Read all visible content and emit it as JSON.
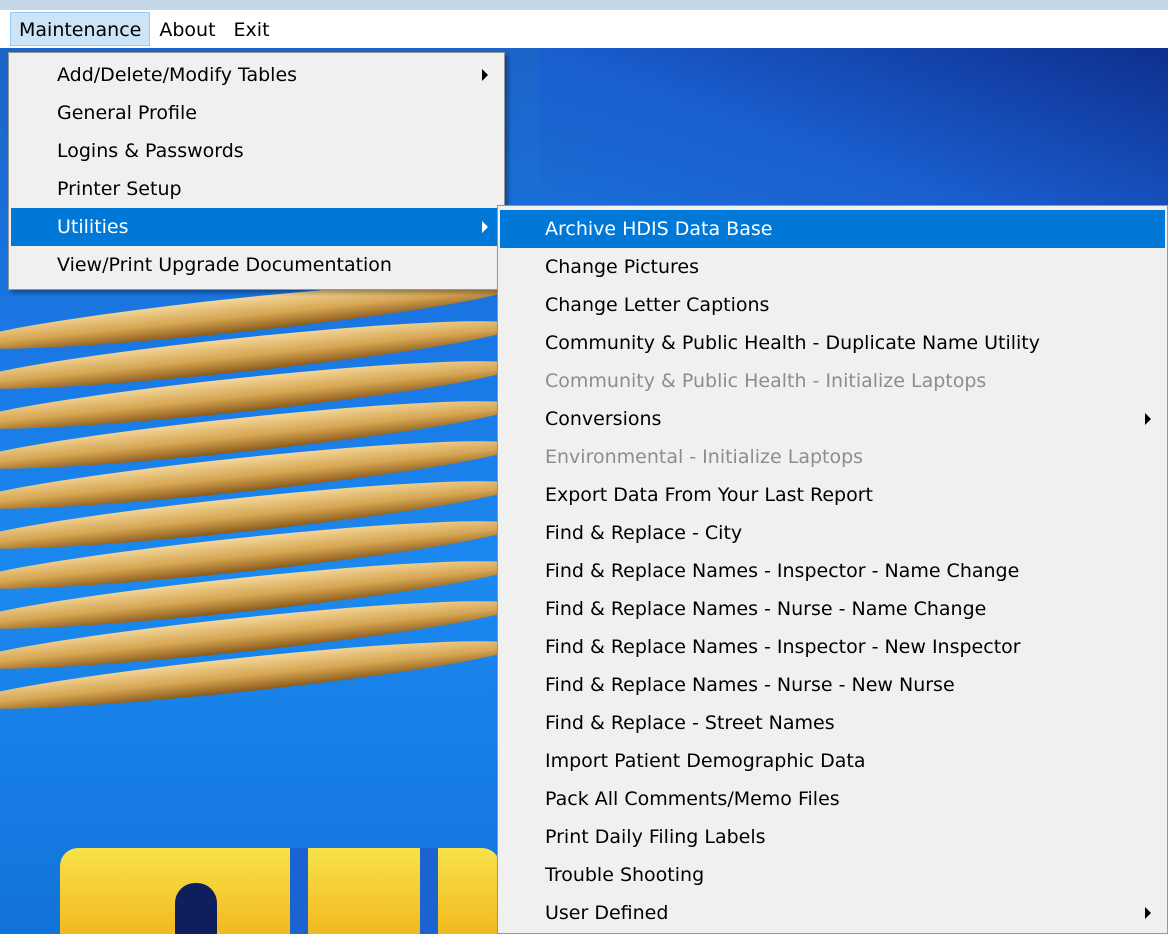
{
  "menubar": {
    "items": [
      "Maintenance",
      "About",
      "Exit"
    ]
  },
  "main_menu": {
    "items": [
      {
        "label": "Add/Delete/Modify Tables",
        "submenu": true
      },
      {
        "label": "General Profile"
      },
      {
        "label": "Logins & Passwords"
      },
      {
        "label": "Printer Setup"
      },
      {
        "label": "Utilities",
        "submenu": true,
        "highlighted": true
      },
      {
        "label": "View/Print Upgrade Documentation"
      }
    ]
  },
  "utilities_menu": {
    "items": [
      {
        "label": "Archive HDIS Data Base",
        "highlighted": true
      },
      {
        "label": "Change Pictures"
      },
      {
        "label": "Change Letter Captions"
      },
      {
        "label": "Community & Public Health - Duplicate Name Utility"
      },
      {
        "label": "Community & Public Health - Initialize Laptops",
        "disabled": true
      },
      {
        "label": "Conversions",
        "submenu": true
      },
      {
        "label": "Environmental - Initialize Laptops",
        "disabled": true
      },
      {
        "label": "Export Data From Your Last Report"
      },
      {
        "label": "Find & Replace - City"
      },
      {
        "label": "Find & Replace Names - Inspector - Name Change"
      },
      {
        "label": "Find & Replace Names - Nurse - Name Change"
      },
      {
        "label": "Find & Replace Names - Inspector - New Inspector"
      },
      {
        "label": "Find & Replace Names - Nurse - New Nurse"
      },
      {
        "label": "Find & Replace - Street Names"
      },
      {
        "label": "Import Patient Demographic Data"
      },
      {
        "label": "Pack All Comments/Memo Files"
      },
      {
        "label": "Print Daily Filing Labels"
      },
      {
        "label": "Trouble Shooting"
      },
      {
        "label": "User Defined",
        "submenu": true
      }
    ]
  },
  "colors": {
    "highlight": "#0078d7",
    "menu_background": "#f0f0f0",
    "disabled_text": "#8d8d8d",
    "menubar_active": "#cce4f7"
  }
}
